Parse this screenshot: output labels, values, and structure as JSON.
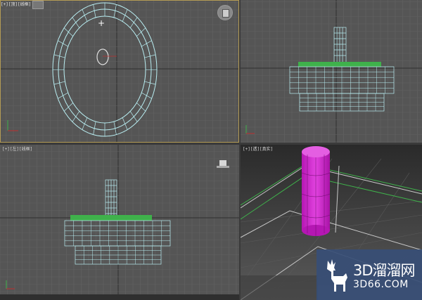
{
  "viewports": {
    "top": {
      "title_text": "[+][顶][线框]"
    },
    "front": {
      "label": ""
    },
    "left": {
      "label": "[+][左][线框]"
    },
    "perspective": {
      "label": "[+][透][真实]"
    }
  },
  "status_bar": {
    "text": ""
  },
  "watermark": {
    "brand": "3D溜溜网",
    "url": "3D66.COM"
  },
  "colors": {
    "viewport_bg": "#555555",
    "grid_line": "#636363",
    "grid_axis": "#2e2e2e",
    "active_border": "#b49b55",
    "wire_cyan": "#b9eef2",
    "wire_green": "#43c443",
    "cylinder_magenta": "#d228cf",
    "watermark_bg": "#374e76"
  },
  "icons": [
    "viewcube-icon",
    "axis-tripod-icon",
    "deer-logo-icon"
  ]
}
